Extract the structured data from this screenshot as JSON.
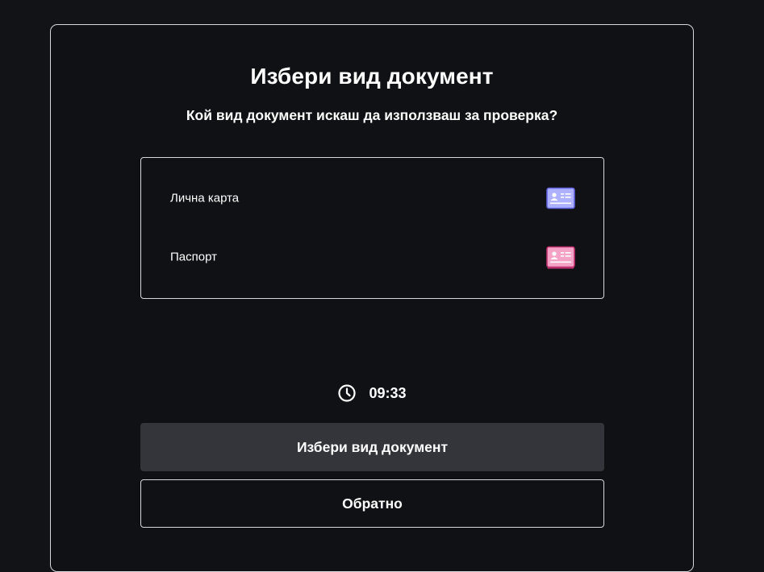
{
  "header": {
    "title": "Избери вид документ",
    "subtitle": "Кой вид документ искаш да използваш за проверка?"
  },
  "document_options": [
    {
      "label": "Лична карта",
      "icon": "id-card-icon",
      "icon_color": "#7b7ff0"
    },
    {
      "label": "Паспорт",
      "icon": "passport-icon",
      "icon_color": "#e879a8"
    }
  ],
  "timer": {
    "icon": "clock-icon",
    "value": "09:33"
  },
  "actions": {
    "primary_label": "Избери вид документ",
    "secondary_label": "Обратно"
  },
  "colors": {
    "background": "#121316",
    "primary_button": "#33353b",
    "border": "#d7d8dc"
  }
}
